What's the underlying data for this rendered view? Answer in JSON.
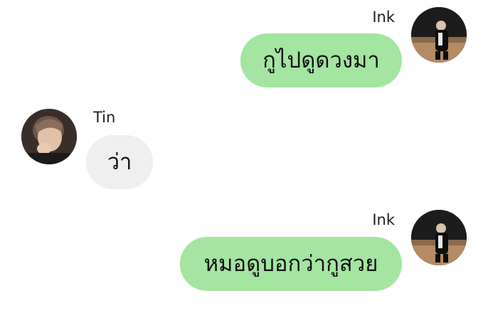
{
  "messages": [
    {
      "sender": "Ink",
      "direction": "outgoing",
      "text": "กูไปดูดวงมา",
      "avatar_icon": "profile-photo-ink"
    },
    {
      "sender": "Tin",
      "direction": "incoming",
      "text": "ว่า",
      "avatar_icon": "profile-photo-tin"
    },
    {
      "sender": "Ink",
      "direction": "outgoing",
      "text": "หมอดูบอกว่ากูสวย",
      "avatar_icon": "profile-photo-ink"
    }
  ],
  "colors": {
    "outgoing_bubble": "#a3e5a1",
    "incoming_bubble": "#efefef",
    "background": "#ffffff",
    "text": "#111111"
  }
}
